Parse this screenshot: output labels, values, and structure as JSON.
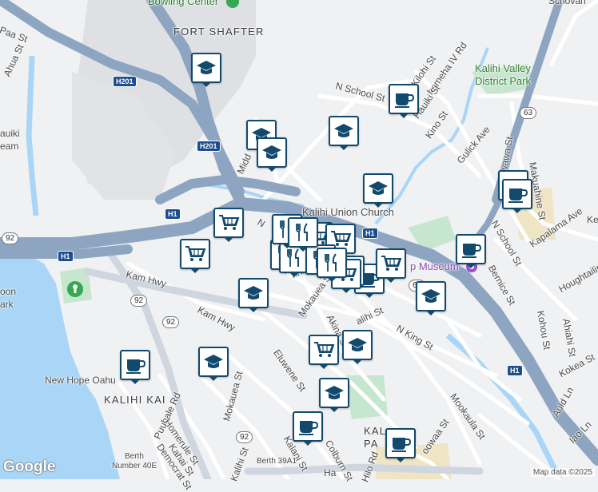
{
  "colors": {
    "water": "#a9d6f7",
    "land": "#f0f1f3",
    "park": "#c7e6cf",
    "military": "#dfe0e3",
    "highway": "#8ea5c2",
    "road": "#ffffff",
    "pin_border": "#124a6e",
    "pin_icon": "#124a6e"
  },
  "map_labels": {
    "bowling": "Bowling Center",
    "fort_shafter": "FORT SHAFTER",
    "paa": "Paa St",
    "ahua": "Ahua St",
    "kauiki": "auiki",
    "eam": "eam",
    "h201_a": "H201",
    "h201_b": "H201",
    "kilohi": "Kilohi St",
    "kamehameha_iv": "hameha IV Rd",
    "n_school_1": "N School St",
    "kalihi_valley_park_1": "Kalihi Valley",
    "kalihi_valley_park_2": "District Park",
    "hauiki": "Hauiki St",
    "kino": "Kino St",
    "gulick": "Gulick Ave",
    "middle": "Midd",
    "kalihi_union": "Kalihi Union Church",
    "h1_a": "H1",
    "h1_b": "H1",
    "h1_c": "H1",
    "h1_d": "H1",
    "n_king_1": "N",
    "n_school_2": "N School St",
    "kapalama": "Kapalama Ave",
    "ke": "Ke",
    "makuahine": "Makuahine St",
    "owawa": "Owawa St",
    "museum": "p Museum",
    "bernice": "Bernice St",
    "houghtailing": "Houghtailing",
    "kam_hwy_1": "Kam Hwy",
    "kam_hwy_2": "Kam Hwy",
    "nnis": "nnis",
    "on_park_1": "oon",
    "on_park_2": "ark",
    "kohou": "Kohou St",
    "ahiahi": "Ahiahi St",
    "mokauea_1": "Mokauea St",
    "akina": "Akina St",
    "n_king_2": "N King St",
    "kalihi_st": "alihi St",
    "eluwene": "Eluwene St",
    "kokea": "Kokea St",
    "new_hope": "New Hope Oahu",
    "kalihi_kai": "KALIHI KAI",
    "mokauea_2": "Mokauea St",
    "puuhale": "Puuhale Rd",
    "homerule": "Homerule St",
    "democrat": "Democrat St",
    "kahai": "Kahai St",
    "kalani": "Kalani St",
    "colburn": "Colburn St",
    "hilo": "Hilo Rd",
    "mookaula": "Mookaula St",
    "auld": "Auld Ln",
    "iao": "Iao Ln",
    "kalihi_park_1": "KAL",
    "kalihi_park_2": "PA",
    "moowaa": "oowaa St",
    "berth_1": "Berth",
    "berth_2": "Number 40E",
    "berth_39": "Berth 39A1",
    "kalihi_st_2": "Kalihi St",
    "ha": "Ha",
    "ounty": "Schovan",
    "route_92_a": "92",
    "route_92_b": "92",
    "route_92_c": "92",
    "route_92_d": "92",
    "route_63": "63",
    "route_61": "61"
  },
  "google_logo": "Google",
  "credit": "Map data ©2025",
  "pins": [
    {
      "type": "school",
      "icon": "mortarboard-icon"
    },
    {
      "type": "school",
      "icon": "mortarboard-icon"
    },
    {
      "type": "school",
      "icon": "mortarboard-icon"
    },
    {
      "type": "school",
      "icon": "mortarboard-icon"
    },
    {
      "type": "school",
      "icon": "mortarboard-icon"
    },
    {
      "type": "school",
      "icon": "mortarboard-icon"
    },
    {
      "type": "school",
      "icon": "mortarboard-icon"
    },
    {
      "type": "school",
      "icon": "mortarboard-icon"
    },
    {
      "type": "school",
      "icon": "mortarboard-icon"
    },
    {
      "type": "school",
      "icon": "mortarboard-icon"
    },
    {
      "type": "cafe",
      "icon": "coffee-cup-icon"
    },
    {
      "type": "cafe",
      "icon": "coffee-cup-icon"
    },
    {
      "type": "cafe",
      "icon": "coffee-cup-icon"
    },
    {
      "type": "cafe",
      "icon": "coffee-cup-icon"
    },
    {
      "type": "cafe",
      "icon": "coffee-cup-icon"
    },
    {
      "type": "cafe",
      "icon": "coffee-cup-icon"
    },
    {
      "type": "cafe",
      "icon": "coffee-cup-icon"
    },
    {
      "type": "cafe",
      "icon": "coffee-cup-icon"
    },
    {
      "type": "grocery",
      "icon": "shopping-cart-icon"
    },
    {
      "type": "grocery",
      "icon": "shopping-cart-icon"
    },
    {
      "type": "grocery",
      "icon": "shopping-cart-icon"
    },
    {
      "type": "grocery",
      "icon": "shopping-cart-icon"
    },
    {
      "type": "grocery",
      "icon": "shopping-cart-icon"
    },
    {
      "type": "grocery",
      "icon": "shopping-cart-icon"
    },
    {
      "type": "grocery",
      "icon": "shopping-cart-icon"
    },
    {
      "type": "grocery",
      "icon": "shopping-cart-icon"
    },
    {
      "type": "grocery",
      "icon": "shopping-cart-icon"
    },
    {
      "type": "restaurant",
      "icon": "fork-knife-icon"
    },
    {
      "type": "restaurant",
      "icon": "fork-knife-icon"
    },
    {
      "type": "restaurant",
      "icon": "fork-knife-icon"
    },
    {
      "type": "restaurant",
      "icon": "fork-knife-icon"
    },
    {
      "type": "restaurant",
      "icon": "fork-knife-icon"
    },
    {
      "type": "restaurant",
      "icon": "fork-knife-icon"
    }
  ]
}
